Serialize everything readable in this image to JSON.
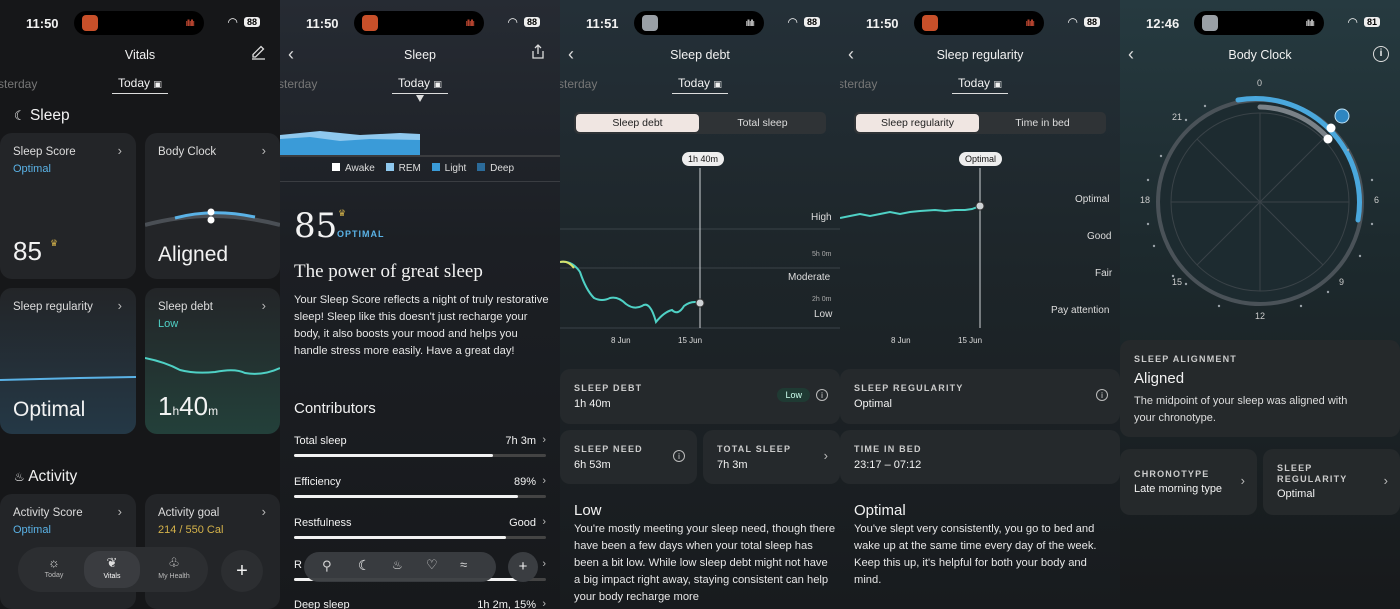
{
  "screen1": {
    "status_time": "11:50",
    "battery": "88",
    "title": "Vitals",
    "yesterday": "sterday",
    "today": "Today",
    "sleep_section": "Sleep",
    "sleep_score": {
      "title": "Sleep Score",
      "status": "Optimal",
      "value": "85"
    },
    "body_clock": {
      "title": "Body Clock",
      "value": "Aligned"
    },
    "sleep_regularity": {
      "title": "Sleep regularity",
      "value": "Optimal"
    },
    "sleep_debt": {
      "title": "Sleep debt",
      "status": "Low",
      "hours": "1",
      "h_unit": "h",
      "minutes": "40",
      "m_unit": "m"
    },
    "activity_section": "Activity",
    "activity_score": {
      "title": "Activity Score",
      "status": "Optimal"
    },
    "activity_goal": {
      "title": "Activity goal",
      "status": "214 / 550 Cal"
    },
    "tabs": [
      {
        "label": "Today"
      },
      {
        "label": "Vitals"
      },
      {
        "label": "My Health"
      }
    ]
  },
  "screen2": {
    "status_time": "11:50",
    "battery": "88",
    "title": "Sleep",
    "yesterday": "sterday",
    "today": "Today",
    "legend": [
      "Awake",
      "REM",
      "Light",
      "Deep"
    ],
    "score": "85",
    "score_label": "OPTIMAL",
    "heading": "The power of great sleep",
    "paragraph": "Your Sleep Score reflects a night of truly restorative sleep! Sleep like this doesn't just recharge your body, it also boosts your mood and helps you handle stress more easily. Have a great day!",
    "contributors_title": "Contributors",
    "contributors": [
      {
        "label": "Total sleep",
        "value": "7h 3m",
        "fill": 0.79
      },
      {
        "label": "Efficiency",
        "value": "89%",
        "fill": 0.89
      },
      {
        "label": "Restfulness",
        "value": "Good",
        "fill": 0.84
      },
      {
        "label": "R",
        "value": "m",
        "fill": 0.9
      },
      {
        "label": "Deep sleep",
        "value": "1h 2m, 15%",
        "fill": 0.7
      }
    ]
  },
  "screen3": {
    "status_time": "11:51",
    "battery": "88",
    "title": "Sleep debt",
    "yesterday": "sterday",
    "today": "Today",
    "seg_on": "Sleep debt",
    "seg_off": "Total sleep",
    "tooltip": "1h 40m",
    "y_labels": [
      "High",
      "5h 0m",
      "Moderate",
      "2h 0m",
      "Low"
    ],
    "x_labels": [
      "8 Jun",
      "15 Jun"
    ],
    "debt": {
      "caption": "SLEEP DEBT",
      "value": "1h 40m",
      "badge": "Low"
    },
    "need": {
      "caption": "SLEEP NEED",
      "value": "6h 53m"
    },
    "total": {
      "caption": "TOTAL SLEEP",
      "value": "7h 3m"
    },
    "result_title": "Low",
    "paragraph": "You're mostly meeting your sleep need, though there have been a few days when your total sleep has been a bit low. While low sleep debt might not have a big impact right away, staying consistent can help your body recharge more"
  },
  "screen4": {
    "status_time": "11:50",
    "battery": "88",
    "title": "Sleep regularity",
    "yesterday": "sterday",
    "today": "Today",
    "seg_on": "Sleep regularity",
    "seg_off": "Time in bed",
    "tooltip": "Optimal",
    "y_labels": [
      "Optimal",
      "Good",
      "Fair",
      "Pay attention"
    ],
    "x_labels": [
      "8 Jun",
      "15 Jun"
    ],
    "regularity": {
      "caption": "SLEEP REGULARITY",
      "value": "Optimal"
    },
    "time_in_bed": {
      "caption": "TIME IN BED",
      "value": "23:17 – 07:12"
    },
    "result_title": "Optimal",
    "paragraph": "You've slept very consistently, you go to bed and wake up at the same time every day of the week. Keep this up, it's helpful for both your body and mind."
  },
  "screen5": {
    "status_time": "12:46",
    "battery": "81",
    "title": "Body Clock",
    "hours": [
      "0",
      "21",
      "18",
      "15",
      "12",
      "9",
      "6"
    ],
    "alignment": {
      "caption": "SLEEP ALIGNMENT",
      "value": "Aligned",
      "desc": "The midpoint of your sleep was aligned with your chronotype."
    },
    "chronotype": {
      "caption": "CHRONOTYPE",
      "value": "Late morning type"
    },
    "regularity": {
      "caption1": "SLEEP",
      "caption2": "REGULARITY",
      "value": "Optimal"
    }
  },
  "colors": {
    "accent_blue": "#5ab2e6",
    "teal": "#4fd1c5",
    "gold": "#d4b24a"
  }
}
